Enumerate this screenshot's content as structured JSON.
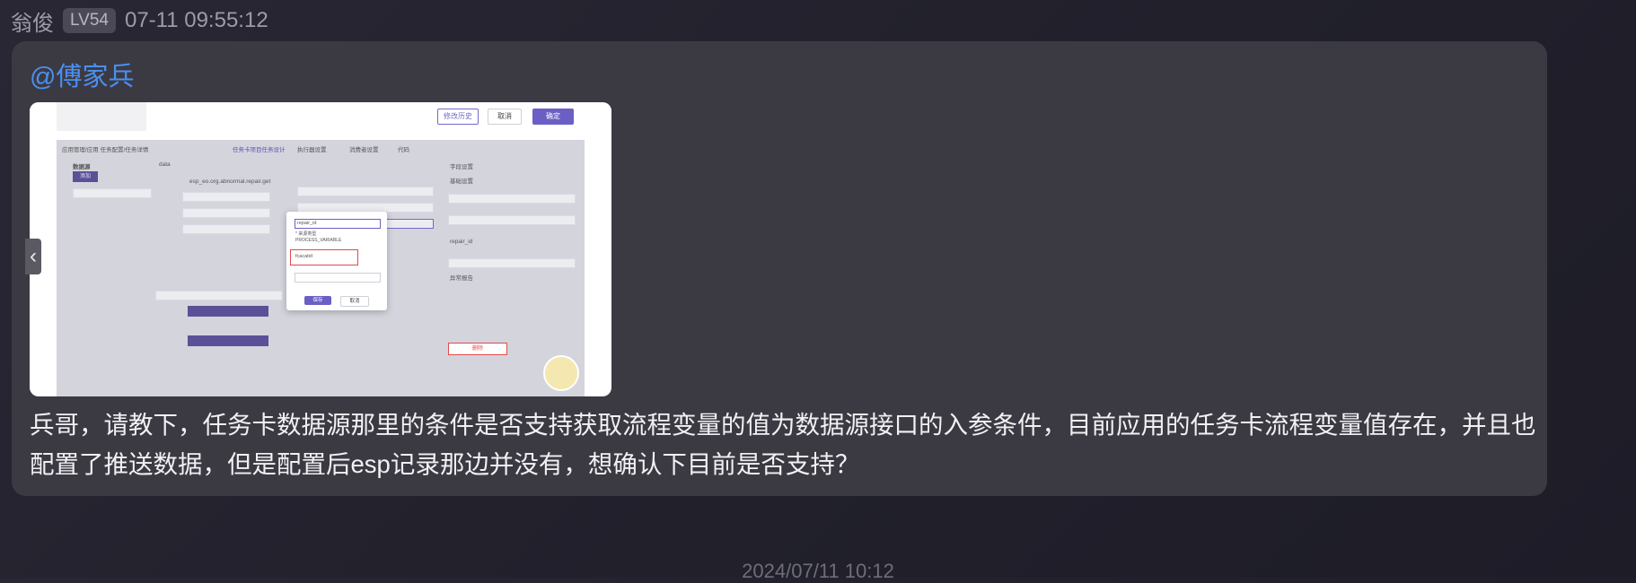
{
  "message": {
    "sender": "翁俊",
    "level": "LV54",
    "time": "07-11 09:55:12",
    "mention": "@傅家兵",
    "text": "兵哥，请教下，任务卡数据源那里的条件是否支持获取流程变量的值为数据源接口的入参条件，目前应用的任务卡流程变量值存在，并且也配置了推送数据，但是配置后esp记录那边并没有，想确认下目前是否支持？"
  },
  "screenshot": {
    "top_buttons": {
      "history": "修改历史",
      "cancel": "取消",
      "confirm": "确定"
    },
    "breadcrumb": "应用管理/应用  任务配置/任务详情",
    "tabs": [
      "任务卡项目任务设计",
      "执行器设置",
      "消费者设置",
      "代码"
    ],
    "panel_title": "数据源",
    "add_label": "添加",
    "field_name": "data",
    "api_url": "esp_eo.org.abnormal.repair.get",
    "modal": {
      "field_value": "repair_id",
      "type_label": "* 来源类型",
      "type_value": "PROCESS_VARIABLE",
      "var_value": "fcacatid",
      "save": "保存",
      "cancel": "取消"
    },
    "right_panel": {
      "title": "字段设置",
      "basic": "基础设置",
      "repair_value": "repair_id",
      "confirm_button": "删除",
      "dataset_label": "异常报告"
    }
  },
  "prev_arrow": "‹",
  "date_separator": "2024/07/11 10:12"
}
